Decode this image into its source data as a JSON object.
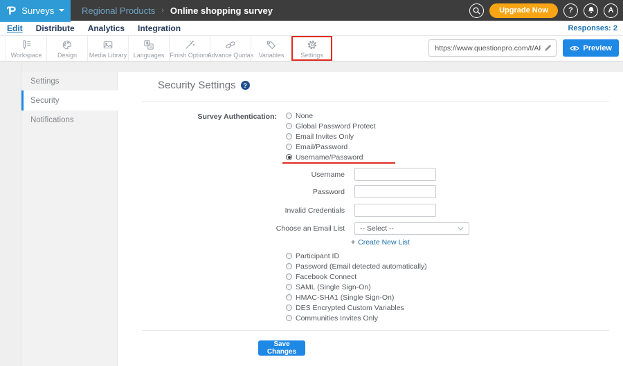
{
  "topbar": {
    "brand": {
      "logo_char": "Ƥ",
      "menu_label": "Surveys"
    },
    "breadcrumb": {
      "parent": "Regional Products",
      "separator": "›",
      "current": "Online shopping survey"
    },
    "upgrade_label": "Upgrade Now",
    "help_badge": "?",
    "avatar_initial": "A"
  },
  "nav": {
    "tabs": [
      {
        "label": "Edit",
        "active": true
      },
      {
        "label": "Distribute",
        "active": false
      },
      {
        "label": "Analytics",
        "active": false
      },
      {
        "label": "Integration",
        "active": false
      }
    ],
    "responses_label": "Responses: 2"
  },
  "toolbar": {
    "items": [
      {
        "label": "Workspace"
      },
      {
        "label": "Design"
      },
      {
        "label": "Media Library"
      },
      {
        "label": "Languages"
      },
      {
        "label": "Finish Options"
      },
      {
        "label": "Advance Quotas"
      },
      {
        "label": "Variables"
      },
      {
        "label": "Settings",
        "highlighted": true
      }
    ],
    "url_value": "https://www.questionpro.com/t/APNrFZ",
    "preview_label": "Preview"
  },
  "sidebar": {
    "items": [
      {
        "label": "Settings",
        "active": false
      },
      {
        "label": "Security",
        "active": true
      },
      {
        "label": "Notifications",
        "active": false
      }
    ]
  },
  "main": {
    "title": "Security Settings",
    "help_badge": "?",
    "auth_label": "Survey Authentication:",
    "auth_options_top": [
      {
        "label": "None",
        "selected": false
      },
      {
        "label": "Global Password Protect",
        "selected": false
      },
      {
        "label": "Email Invites Only",
        "selected": false
      },
      {
        "label": "Email/Password",
        "selected": false
      },
      {
        "label": "Username/Password",
        "selected": true
      }
    ],
    "fields": [
      {
        "label": "Username",
        "value": ""
      },
      {
        "label": "Password",
        "value": ""
      },
      {
        "label": "Invalid Credentials",
        "value": ""
      }
    ],
    "email_list_label": "Choose an Email List",
    "email_list_value": "-- Select --",
    "create_link_plus": "+",
    "create_link_label": "Create New List",
    "auth_options_bottom": [
      {
        "label": "Participant ID"
      },
      {
        "label": "Password (Email detected automatically)"
      },
      {
        "label": "Facebook Connect"
      },
      {
        "label": "SAML (Single Sign-On)"
      },
      {
        "label": "HMAC-SHA1 (Single Sign-On)"
      },
      {
        "label": "DES Encrypted Custom Variables"
      },
      {
        "label": "Communities Invites Only"
      }
    ],
    "save_label": "Save Changes"
  },
  "colors": {
    "topbar_bg": "#3d3d3d",
    "brand_blue": "#2e9bd6",
    "accent_blue": "#1e88e5",
    "link_blue": "#1a6fad",
    "upgrade_orange": "#f7a515",
    "annotation_red": "#e02b20",
    "sidebar_bg": "#f2f2f2",
    "page_bg": "#efefef"
  }
}
